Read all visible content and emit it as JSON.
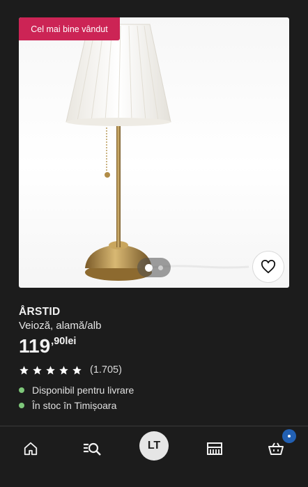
{
  "product": {
    "badge": "Cel mai bine vândut",
    "name": "ÅRSTID",
    "description": "Veioză, alamă/alb",
    "price_integer": "119",
    "price_decimal": ",90lei",
    "rating_stars": 5,
    "rating_count": "(1.705)",
    "availability": [
      {
        "text": "Disponibil pentru livrare",
        "status_color": "#7ec77a"
      },
      {
        "text": "În stoc în Timișoara",
        "status_color": "#7ec77a"
      }
    ],
    "image_carousel": {
      "total": 2,
      "active": 1
    }
  },
  "nav": {
    "items": [
      {
        "name": "home",
        "icon": "home-icon"
      },
      {
        "name": "search",
        "icon": "search-list-icon"
      },
      {
        "name": "profile",
        "label": "LT"
      },
      {
        "name": "store",
        "icon": "store-icon"
      },
      {
        "name": "cart",
        "icon": "cart-icon"
      }
    ],
    "profile_label": "LT",
    "cart_badge_color": "#2260b3"
  },
  "colors": {
    "background": "#1c1c1c",
    "badge": "#cc2455",
    "available": "#7ec77a"
  }
}
